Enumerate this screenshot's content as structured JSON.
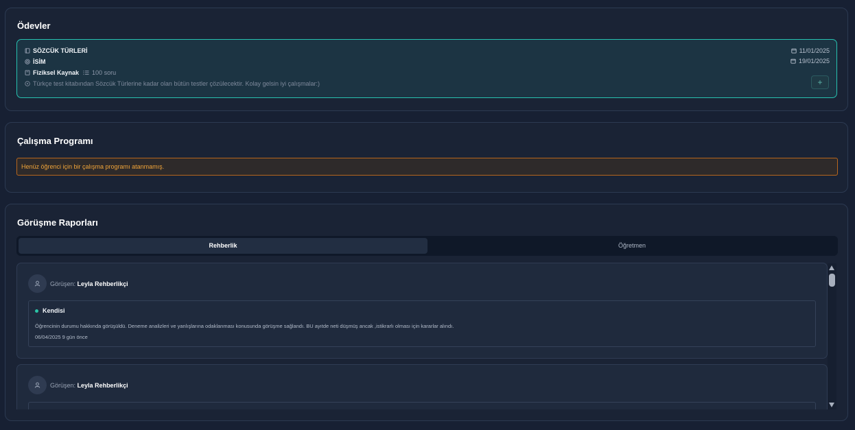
{
  "assignments": {
    "title": "Ödevler",
    "item": {
      "topic": "SÖZCÜK TÜRLERİ",
      "subject": "İSİM",
      "source": "Fiziksel Kaynak",
      "question_count": "100 soru",
      "description": "Türkçe test kitabından Sözcük Türlerine kadar olan bütün testler çözülecektir. Kolay gelsin iyi çalışmalar:)",
      "start_date": "11/01/2025",
      "end_date": "19/01/2025",
      "add_label": "+"
    },
    "icons": [
      "book-icon",
      "target-icon",
      "bookmark-icon",
      "list-icon",
      "info-icon",
      "calendar-icon"
    ],
    "accent": "#27c2b1"
  },
  "program": {
    "title": "Çalışma Programı",
    "warning": "Henüz öğrenci için bir çalışma programı atanmamış.",
    "warning_color": "#f0a43a"
  },
  "reports": {
    "title": "Görüşme Raporları",
    "tabs": [
      {
        "label": "Rehberlik",
        "active": true
      },
      {
        "label": "Öğretmen",
        "active": false
      }
    ],
    "items": [
      {
        "interviewer_prefix": "Görüşen:",
        "interviewer_name": "Leyla Rehberlikçi",
        "type": "Kendisi",
        "text": "Öğrencinin durumu hakkında görüşüldü. Deneme analizleri ve yanlışlarına odaklanması konusunda görüşme sağlandı. BU ayıtde neti düşmüş ancak ,istikrarlı olması için kararlar alındı.",
        "date": "06/04/2025 9 gün önce"
      },
      {
        "interviewer_prefix": "Görüşen:",
        "interviewer_name": "Leyla Rehberlikçi"
      }
    ]
  }
}
